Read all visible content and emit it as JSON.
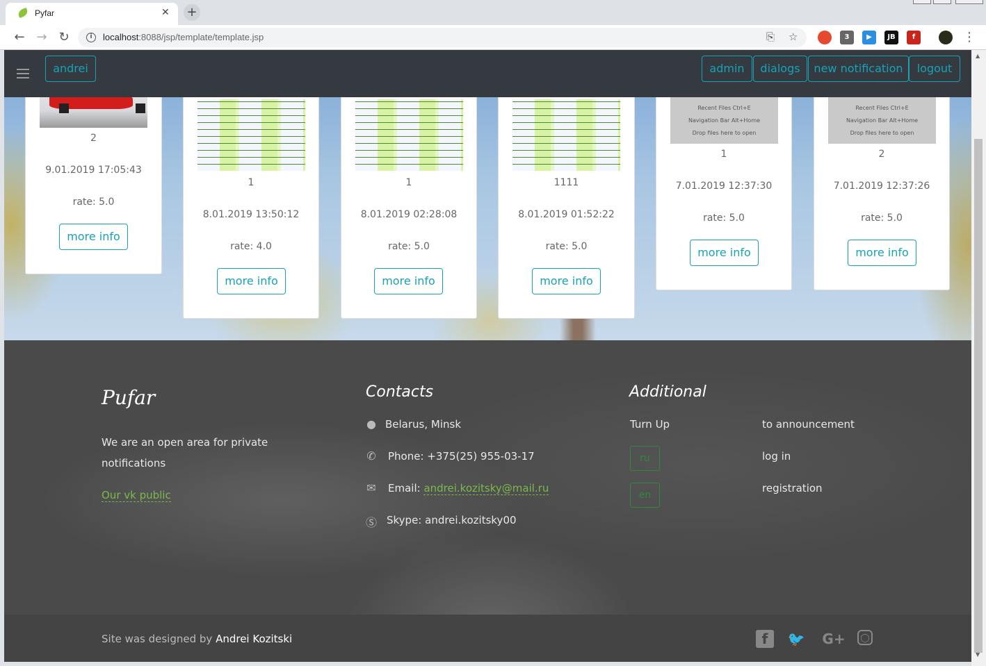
{
  "browser": {
    "tab_title": "Pyfar",
    "tab_close": "✕",
    "new_tab": "+",
    "url_host": "localhost",
    "url_path": ":8088/jsp/template/template.jsp",
    "ext_badge": "3"
  },
  "navbar": {
    "user": "andrei",
    "buttons": [
      "admin",
      "dialogs",
      "new notification",
      "logout"
    ]
  },
  "cards": [
    {
      "title": "2",
      "date": "9.01.2019 17:05:43",
      "rate": "rate: 5.0",
      "button": "more info",
      "image": "red-car"
    },
    {
      "title": "1",
      "date": "8.01.2019 13:50:12",
      "rate": "rate: 4.0",
      "button": "more info",
      "image": "spreadsheet"
    },
    {
      "title": "1",
      "date": "8.01.2019 02:28:08",
      "rate": "rate: 5.0",
      "button": "more info",
      "image": "spreadsheet"
    },
    {
      "title": "1111",
      "date": "8.01.2019 01:52:22",
      "rate": "rate: 5.0",
      "button": "more info",
      "image": "spreadsheet"
    },
    {
      "title": "1",
      "date": "7.01.2019 12:37:30",
      "rate": "rate: 5.0",
      "button": "more info",
      "image": "ide-screenshot"
    },
    {
      "title": "2",
      "date": "7.01.2019 12:37:26",
      "rate": "rate: 5.0",
      "button": "more info",
      "image": "ide-screenshot"
    }
  ],
  "screenshot_text": [
    "Recent Files Ctrl+E",
    "Navigation Bar Alt+Home",
    "Drop files here to open"
  ],
  "footer": {
    "logo": "Pufar",
    "about_line1": "We are an open area for private",
    "about_line2": "notifications",
    "vk_link": "Our vk public",
    "contacts_title": "Contacts",
    "location": "Belarus, Minsk",
    "phone": "Phone: +375(25) 955-03-17",
    "email_label": "Email: ",
    "email": "andrei.kozitsky@mail.ru",
    "skype": "Skype: andrei.kozitsky00",
    "additional_title": "Additional",
    "turn_up": "Turn Up",
    "lang_ru": "ru",
    "lang_en": "en",
    "to_announcement": "to announcement",
    "log_in": "log in",
    "registration": "registration"
  },
  "copyright": {
    "prefix": "Site was designed by ",
    "author": "Andrei Kozitski"
  },
  "social": [
    "facebook-icon",
    "twitter-icon",
    "google-plus-icon",
    "instagram-icon"
  ],
  "colors": {
    "accent": "#17a2b8",
    "navbar": "#343a40",
    "green": "#7aba4a"
  }
}
